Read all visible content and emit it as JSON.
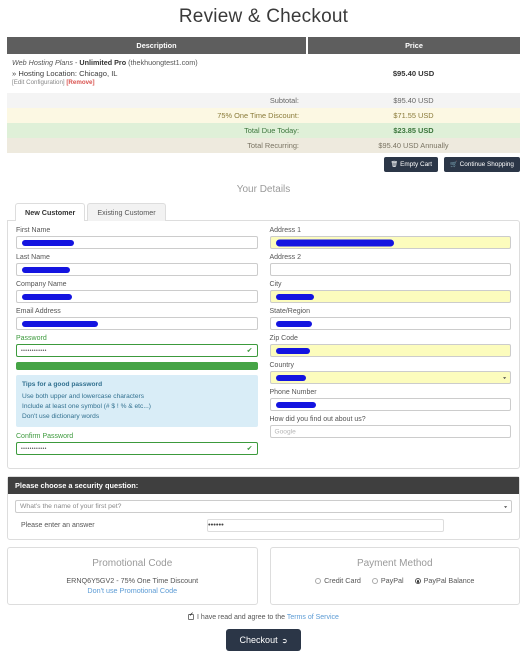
{
  "page_title": "Review & Checkout",
  "cart": {
    "headers": [
      "Description",
      "Price"
    ],
    "item": {
      "plan_group": "Web Hosting Plans",
      "plan_sep": " - ",
      "plan_name": "Unlimited Pro",
      "domain": "(thekhuongtest1.com)",
      "location": "» Hosting Location: Chicago, IL",
      "edit_label": "[Edit Configuration]",
      "remove_label": "[Remove]",
      "price": "$95.40 USD"
    },
    "summary_rows": [
      {
        "label": "Subtotal:",
        "value": "$95.40 USD"
      },
      {
        "label": "75% One Time Discount:",
        "value": "$71.55 USD"
      },
      {
        "label": "Total Due Today:",
        "value": "$23.85 USD"
      },
      {
        "label": "Total Recurring:",
        "value": "$95.40 USD Annually"
      }
    ],
    "buttons": {
      "empty_cart": "Empty Cart",
      "empty_cart_icon": "trash-icon",
      "continue_shopping": "Continue Shopping",
      "continue_shopping_icon": "cart-icon"
    }
  },
  "details": {
    "section_title": "Your Details",
    "tabs": [
      {
        "label": "New Customer",
        "active": true
      },
      {
        "label": "Existing Customer",
        "active": false
      }
    ],
    "left_fields": [
      {
        "label": "First Name",
        "redacted": true
      },
      {
        "label": "Last Name",
        "redacted": true
      },
      {
        "label": "Company Name",
        "redacted": true
      },
      {
        "label": "Email Address",
        "redacted": true
      }
    ],
    "password": {
      "label": "Password",
      "value_mask": "••••••••••••",
      "valid_icon": "check-icon",
      "strength": "strong",
      "strength_color": "#45a445",
      "tips_title": "Tips for a good password",
      "tips": [
        "Use both upper and lowercase characters",
        "Include at least one symbol (# $ ! % & etc...)",
        "Don't use dictionary words"
      ]
    },
    "confirm_password": {
      "label": "Confirm Password",
      "value_mask": "••••••••••••",
      "valid_icon": "check-icon"
    },
    "right_fields": [
      {
        "label": "Address 1",
        "redacted": true,
        "autofill": true
      },
      {
        "label": "Address 2",
        "redacted": false,
        "autofill": false
      },
      {
        "label": "City",
        "redacted": true,
        "autofill": true
      },
      {
        "label": "State/Region",
        "redacted": true,
        "autofill": false
      },
      {
        "label": "Zip Code",
        "redacted": true,
        "autofill": true
      },
      {
        "label": "Country",
        "redacted": true,
        "autofill": true,
        "select": true
      },
      {
        "label": "Phone Number",
        "redacted": true,
        "autofill": false
      }
    ],
    "referral": {
      "label": "How did you find out about us?",
      "placeholder": "Google",
      "value": ""
    }
  },
  "security": {
    "header": "Please choose a security question:",
    "selected_question": "What's the name of your first pet?",
    "answer_label": "Please enter an answer",
    "answer_mask": "••••••"
  },
  "promo": {
    "title": "Promotional Code",
    "code_text": "ERNQ6Y5GV2 - 75% One Time Discount",
    "remove_link": "Don't use Promotional Code"
  },
  "payment": {
    "title": "Payment Method",
    "options": [
      {
        "label": "Credit Card",
        "selected": false
      },
      {
        "label": "PayPal",
        "selected": false
      },
      {
        "label": "PayPal Balance",
        "selected": true
      }
    ]
  },
  "terms": {
    "checked": true,
    "text": "I have read and agree to the",
    "link": "Terms of Service"
  },
  "checkout": {
    "label": "Checkout",
    "icon": "arrow-circle-right-icon"
  }
}
